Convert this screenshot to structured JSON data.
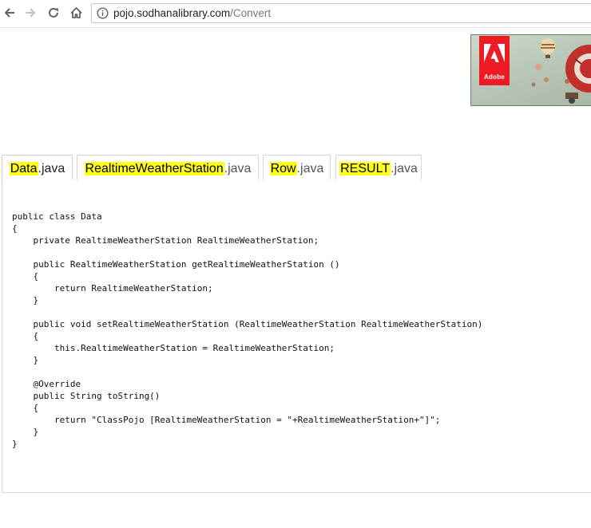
{
  "browser": {
    "url_host": "pojo.sodhanalibrary.com",
    "url_path": "/Convert"
  },
  "ad": {
    "brand": "Adobe"
  },
  "tabs": [
    {
      "name": "Data",
      "ext": ".java",
      "active": true
    },
    {
      "name": "RealtimeWeatherStation",
      "ext": ".java",
      "active": false
    },
    {
      "name": "Row",
      "ext": ".java",
      "active": false
    },
    {
      "name": "RESULT",
      "ext": ".java",
      "active": false
    }
  ],
  "code": {
    "lines": [
      "public class Data",
      "{",
      "    private RealtimeWeatherStation RealtimeWeatherStation;",
      "",
      "    public RealtimeWeatherStation getRealtimeWeatherStation ()",
      "    {",
      "        return RealtimeWeatherStation;",
      "    }",
      "",
      "    public void setRealtimeWeatherStation (RealtimeWeatherStation RealtimeWeatherStation)",
      "    {",
      "        this.RealtimeWeatherStation = RealtimeWeatherStation;",
      "    }",
      "",
      "    @Override",
      "    public String toString()",
      "    {",
      "        return \"ClassPojo [RealtimeWeatherStation = \"+RealtimeWeatherStation+\"]\";",
      "    }",
      "}"
    ]
  }
}
